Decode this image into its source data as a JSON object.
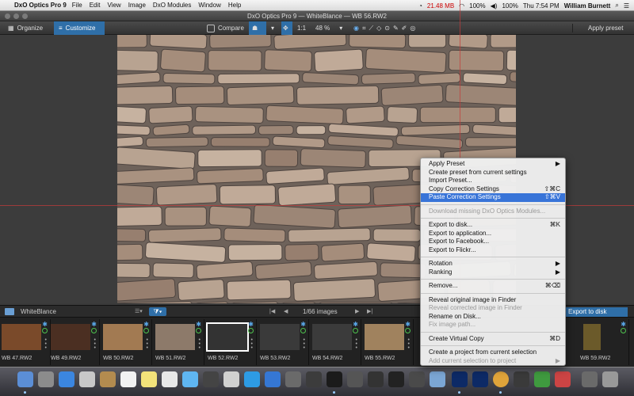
{
  "menubar": {
    "app": "DxO Optics Pro 9",
    "items": [
      "File",
      "Edit",
      "View",
      "Image",
      "DxO Modules",
      "Window",
      "Help"
    ],
    "memory": "21.48 MB",
    "battery": "100%",
    "battery2": "100%",
    "clock": "Thu 7:54 PM",
    "user": "William Burnett"
  },
  "window": {
    "title": "DxO Optics Pro 9 — WhiteBlance — WB 56.RW2"
  },
  "toolbar": {
    "organize": "Organize",
    "customize": "Customize",
    "compare": "Compare",
    "ratio": "1:1",
    "zoom": "48 %",
    "apply_preset": "Apply preset"
  },
  "filmhead": {
    "project": "WhiteBlance",
    "count": "1/66 images",
    "export": "Export to disk"
  },
  "thumbs": [
    {
      "label": "WB 47.RW2",
      "color": "#7a4a2a"
    },
    {
      "label": "WB 49.RW2",
      "color": "#4b2f22"
    },
    {
      "label": "WB 50.RW2",
      "color": "#a27a52"
    },
    {
      "label": "WB 51.RW2",
      "color": "#8d7a6a"
    },
    {
      "label": "WB 52.RW2",
      "color": "#333333"
    },
    {
      "label": "WB 53.RW2",
      "color": "#3a3a3a"
    },
    {
      "label": "WB 54.RW2",
      "color": "#3b3b3b"
    },
    {
      "label": "WB 55.RW2",
      "color": "#a0825e"
    },
    {
      "label": "WB 59.RW2",
      "color": "#6b5a2a"
    }
  ],
  "context_menu": {
    "apply_preset": "Apply Preset",
    "create_preset": "Create preset from current settings",
    "import_preset": "Import Preset...",
    "copy_settings": "Copy Correction Settings",
    "copy_sc": "⇧⌘C",
    "paste_settings": "Paste Correction Settings",
    "paste_sc": "⇧⌘V",
    "download_missing": "Download missing DxO Optics Modules...",
    "export_disk": "Export to disk...",
    "export_disk_sc": "⌘K",
    "export_app": "Export to application...",
    "export_facebook": "Export to Facebook...",
    "export_flickr": "Export to Flickr...",
    "rotation": "Rotation",
    "ranking": "Ranking",
    "remove": "Remove...",
    "remove_sc": "⌘⌫",
    "reveal_original": "Reveal original image in Finder",
    "reveal_corrected": "Reveal corrected image in Finder",
    "rename": "Rename on Disk...",
    "fix_path": "Fix image path...",
    "virtual_copy": "Create Virtual Copy",
    "virtual_copy_sc": "⌘D",
    "create_project": "Create a project from current selection",
    "add_selection": "Add current selection to project"
  }
}
